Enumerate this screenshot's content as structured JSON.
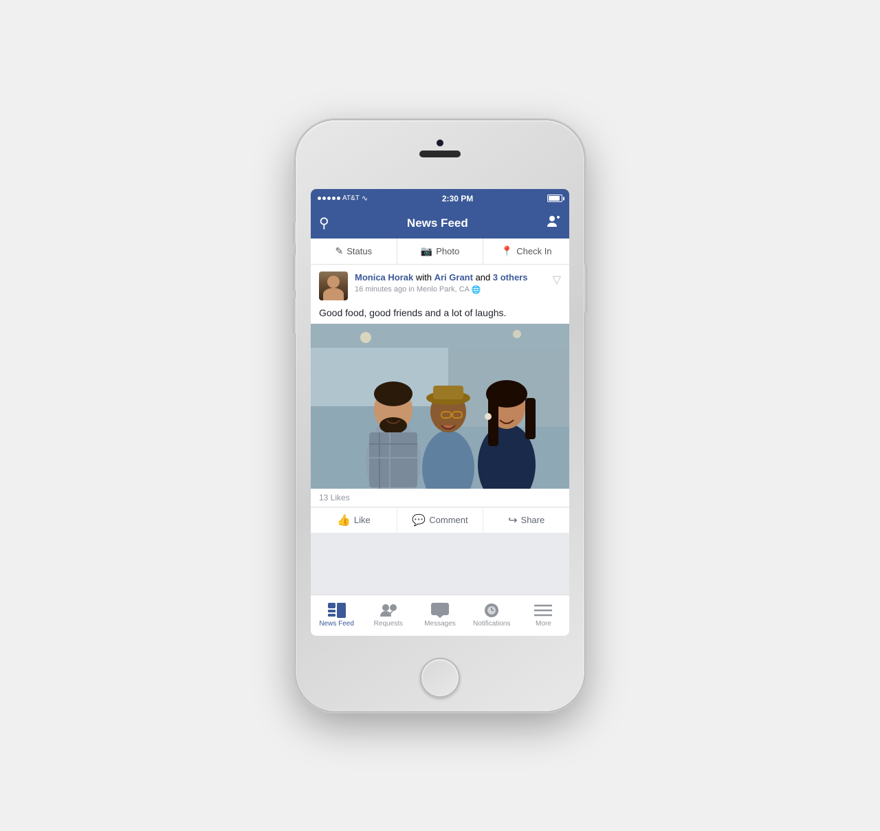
{
  "phone": {
    "carrier": "AT&T",
    "time": "2:30 PM",
    "signal_dots": 5
  },
  "header": {
    "title": "News Feed",
    "search_icon": "🔍",
    "friend_icon": "👤"
  },
  "action_buttons": [
    {
      "id": "status",
      "icon": "✏️",
      "label": "Status"
    },
    {
      "id": "photo",
      "icon": "📷",
      "label": "Photo"
    },
    {
      "id": "checkin",
      "icon": "📍",
      "label": "Check In"
    }
  ],
  "post": {
    "author": "Monica Horak",
    "with": "Ari Grant",
    "others_count": "3 others",
    "time": "16 minutes ago in Menlo Park, CA",
    "text": "Good food, good friends and a lot of laughs.",
    "likes_count": "13 Likes",
    "actions": [
      {
        "id": "like",
        "icon": "👍",
        "label": "Like"
      },
      {
        "id": "comment",
        "icon": "💬",
        "label": "Comment"
      },
      {
        "id": "share",
        "icon": "↪",
        "label": "Share"
      }
    ]
  },
  "tab_bar": {
    "items": [
      {
        "id": "news-feed",
        "label": "News Feed",
        "active": true
      },
      {
        "id": "requests",
        "label": "Requests",
        "active": false
      },
      {
        "id": "messages",
        "label": "Messages",
        "active": false
      },
      {
        "id": "notifications",
        "label": "Notifications",
        "active": false
      },
      {
        "id": "more",
        "label": "More",
        "active": false
      }
    ]
  }
}
